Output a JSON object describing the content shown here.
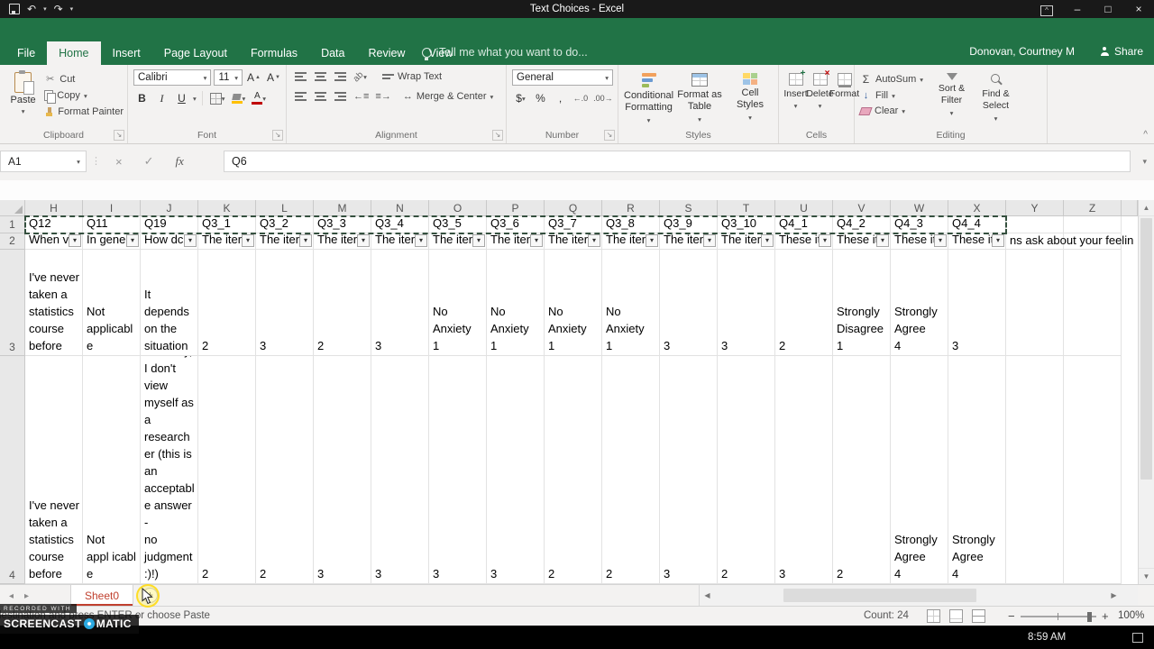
{
  "titlebar": {
    "title": "Text Choices - Excel"
  },
  "ribbon_tabs": [
    "File",
    "Home",
    "Insert",
    "Page Layout",
    "Formulas",
    "Data",
    "Review",
    "View"
  ],
  "active_tab": "Home",
  "tell_me": "Tell me what you want to do...",
  "account_name": "Donovan, Courtney M",
  "share_label": "Share",
  "ribbon": {
    "clipboard": {
      "label": "Clipboard",
      "paste": "Paste",
      "cut": "Cut",
      "copy": "Copy",
      "format_painter": "Format Painter"
    },
    "font": {
      "label": "Font",
      "family": "Calibri",
      "size": "11",
      "bold": "B",
      "italic": "I",
      "underline": "U"
    },
    "alignment": {
      "label": "Alignment",
      "wrap_text": "Wrap Text",
      "merge_center": "Merge & Center"
    },
    "number": {
      "label": "Number",
      "format": "General",
      "currency": "$",
      "percent": "%",
      "comma": ","
    },
    "styles": {
      "label": "Styles",
      "conditional_formatting": "Conditional\nFormatting",
      "format_as_table": "Format as\nTable",
      "cell_styles": "Cell\nStyles"
    },
    "cells": {
      "label": "Cells",
      "insert": "Insert",
      "delete": "Delete",
      "format": "Format"
    },
    "editing": {
      "label": "Editing",
      "autosum": "AutoSum",
      "fill": "Fill",
      "clear": "Clear",
      "sort_filter": "Sort &\nFilter",
      "find_select": "Find &\nSelect"
    }
  },
  "formula_bar": {
    "name_box": "A1",
    "fx_label": "fx",
    "content": "Q6"
  },
  "grid": {
    "columns": [
      "H",
      "I",
      "J",
      "K",
      "L",
      "M",
      "N",
      "O",
      "P",
      "Q",
      "R",
      "S",
      "T",
      "U",
      "V",
      "W",
      "X",
      "Y",
      "Z"
    ],
    "marquee_range": "H1:X1",
    "rows": [
      {
        "n": "1",
        "cells": {
          "H": "Q12",
          "I": "Q11",
          "J": "Q19",
          "K": "Q3_1",
          "L": "Q3_2",
          "M": "Q3_3",
          "N": "Q3_4",
          "O": "Q3_5",
          "P": "Q3_6",
          "Q": "Q3_7",
          "R": "Q3_8",
          "S": "Q3_9",
          "T": "Q3_10",
          "U": "Q4_1",
          "V": "Q4_2",
          "W": "Q4_3",
          "X": "Q4_4"
        }
      },
      {
        "n": "2",
        "filters": [
          "H",
          "I",
          "J",
          "K",
          "L",
          "M",
          "N",
          "O",
          "P",
          "Q",
          "R",
          "S",
          "T",
          "U",
          "V",
          "W",
          "X"
        ],
        "cells": {
          "H": "When v",
          "I": "In gene",
          "J": "How dc",
          "K": "The iter",
          "L": "The iter",
          "M": "The iter",
          "N": "The iter",
          "O": "The iter",
          "P": "The iter",
          "Q": "The iter",
          "R": "The iter",
          "S": "The iter",
          "T": "The iter",
          "U": "These it",
          "V": "These it",
          "W": "These it",
          "X": "These it"
        },
        "spill_text": "ns ask about your feelin"
      },
      {
        "n": "3",
        "cells": {
          "H": "I've never\ntaken a\nstatistics\ncourse\nbefore",
          "I": "Not\napplicabl\ne",
          "J": "It\ndepends\non the\nsituation",
          "K": "2",
          "L": "3",
          "M": "2",
          "N": "3",
          "O": "No\nAnxiety\n1",
          "P": "No\nAnxiety\n1",
          "Q": "No\nAnxiety\n1",
          "R": "No\nAnxiety\n1",
          "S": "3",
          "T": "3",
          "U": "2",
          "V": "Strongly\nDisagree\n1",
          "W": "Strongly\nAgree\n4",
          "X": "3"
        }
      },
      {
        "n": "4",
        "cells": {
          "H": "I've never\ntaken a\nstatistics\ncourse\nbefore",
          "I": "Not\nappl icabl\ne",
          "J": "Honestly,\nI don't\nview\nmyself as\na\nresearch\ner (this is\nan\nacceptabl\ne answer -\nno\njudgment\n:)!)",
          "K": "2",
          "L": "2",
          "M": "3",
          "N": "3",
          "O": "3",
          "P": "3",
          "Q": "2",
          "R": "2",
          "S": "3",
          "T": "2",
          "U": "3",
          "V": "2",
          "W": "Strongly\nAgree\n4",
          "X": "Strongly\nAgree\n4"
        }
      }
    ]
  },
  "sheet_tabs": {
    "active": "Sheet0"
  },
  "status_bar": {
    "message": "Select destination and press ENTER or choose Paste",
    "count_label": "Count: 24",
    "zoom_level": "100%"
  },
  "watermark": {
    "line1": "RECORDED WITH",
    "brand_left": "SCREENCAST",
    "brand_right": "MATIC"
  },
  "clock": {
    "time": "8:59 AM"
  },
  "colors": {
    "ribbon_green": "#217346",
    "tab_red": "#c0402e",
    "marquee": "#35503f",
    "wm_blue": "#2aa9e1"
  }
}
